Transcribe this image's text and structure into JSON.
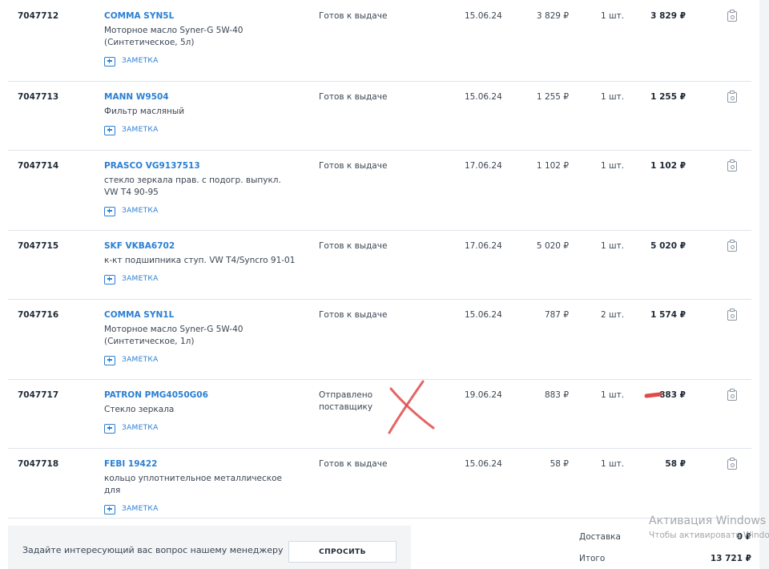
{
  "orders": [
    {
      "id": "7047712",
      "name": "COMMA SYN5L",
      "desc": "Моторное масло Syner-G 5W-40 (Синтетическое, 5л)",
      "note": "ЗАМЕТКА",
      "status": "Готов к выдаче",
      "date": "15.06.24",
      "price": "3 829 ₽",
      "qty": "1 шт.",
      "total": "3 829 ₽"
    },
    {
      "id": "7047713",
      "name": "MANN W9504",
      "desc": "Фильтр масляный",
      "note": "ЗАМЕТКА",
      "status": "Готов к выдаче",
      "date": "15.06.24",
      "price": "1 255 ₽",
      "qty": "1 шт.",
      "total": "1 255 ₽"
    },
    {
      "id": "7047714",
      "name": "PRASCO VG9137513",
      "desc": "стекло зеркала прав. с подогр. выпукл. VW T4 90-95",
      "note": "ЗАМЕТКА",
      "status": "Готов к выдаче",
      "date": "17.06.24",
      "price": "1 102 ₽",
      "qty": "1 шт.",
      "total": "1 102 ₽"
    },
    {
      "id": "7047715",
      "name": "SKF VKBA6702",
      "desc": "к-кт подшипника ступ. VW T4/Syncro 91-01",
      "note": "ЗАМЕТКА",
      "status": "Готов к выдаче",
      "date": "17.06.24",
      "price": "5 020 ₽",
      "qty": "1 шт.",
      "total": "5 020 ₽"
    },
    {
      "id": "7047716",
      "name": "COMMA SYN1L",
      "desc": "Моторное масло Syner-G 5W-40 (Синтетическое, 1л)",
      "note": "ЗАМЕТКА",
      "status": "Готов к выдаче",
      "date": "15.06.24",
      "price": "787 ₽",
      "qty": "2 шт.",
      "total": "1 574 ₽"
    },
    {
      "id": "7047717",
      "name": "PATRON PMG4050G06",
      "desc": "Стекло зеркала",
      "note": "ЗАМЕТКА",
      "status": "Отправлено поставщику",
      "date": "19.06.24",
      "price": "883 ₽",
      "qty": "1 шт.",
      "total": "883 ₽"
    },
    {
      "id": "7047718",
      "name": "FEBI 19422",
      "desc": "кольцо уплотнительное металлическое для",
      "note": "ЗАМЕТКА",
      "status": "Готов к выдаче",
      "date": "15.06.24",
      "price": "58 ₽",
      "qty": "1 шт.",
      "total": "58 ₽"
    }
  ],
  "question": {
    "text": "Задайте интересующий вас вопрос нашему менеджеру",
    "button": "СПРОСИТЬ"
  },
  "summary": {
    "delivery_label": "Доставка",
    "delivery_value": "0 ₽",
    "total_label": "Итого",
    "total_value": "13 721 ₽"
  },
  "watermark": {
    "title": "Активация Windows",
    "subtitle": "Чтобы активировать Windows"
  },
  "colors": {
    "link": "#2a7fd4",
    "annotation": "#e04a4a"
  },
  "icons": {
    "note": "note-add-icon",
    "row_action": "clipboard-icon"
  }
}
